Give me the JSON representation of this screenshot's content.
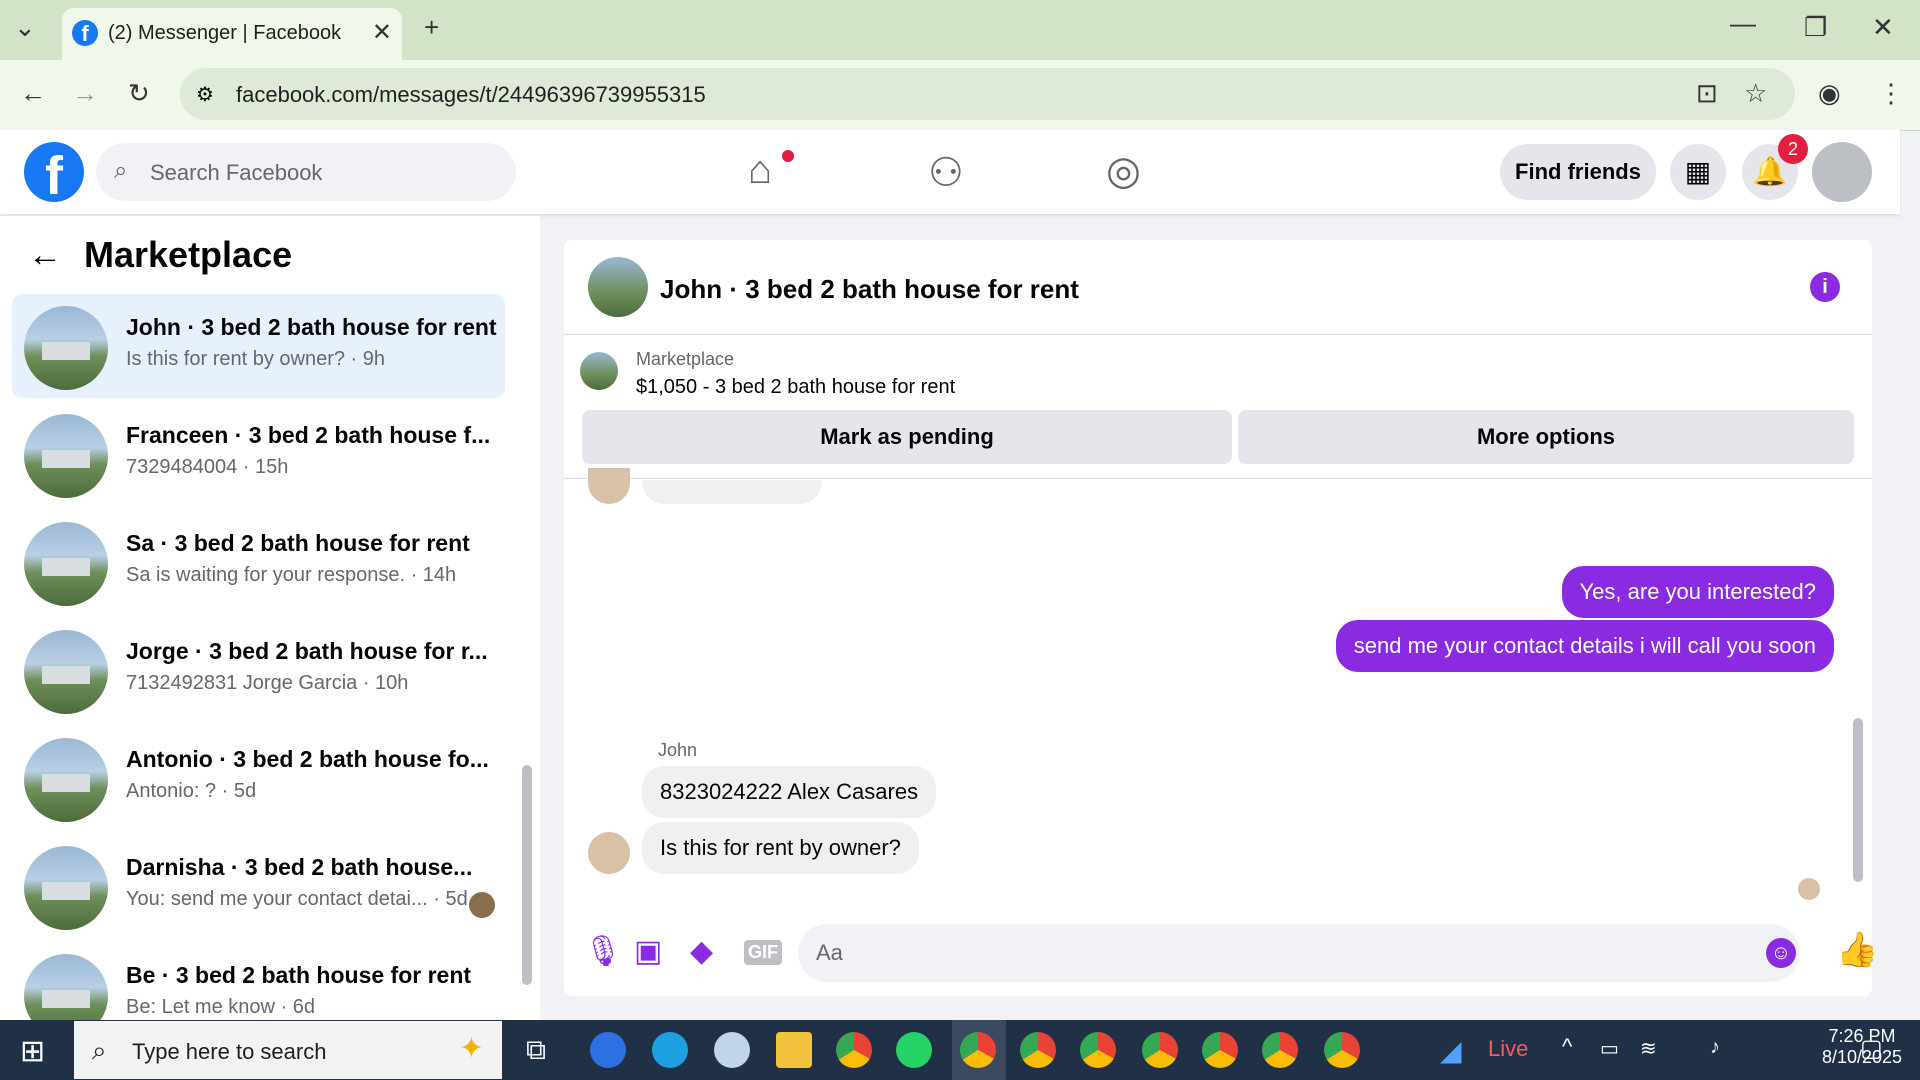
{
  "browser": {
    "tab_title": "(2) Messenger | Facebook",
    "url": "facebook.com/messages/t/24496396739955315"
  },
  "header": {
    "search_placeholder": "Search Facebook",
    "find_friends": "Find friends",
    "notifications_count": "2"
  },
  "sidebar": {
    "title": "Marketplace",
    "conversations": [
      {
        "name": "John · 3 bed 2 bath house for rent",
        "preview": "Is this for rent by owner? · 9h",
        "active": true
      },
      {
        "name": "Franceen · 3 bed 2 bath house f...",
        "preview": "7329484004 · 15h"
      },
      {
        "name": "Sa · 3 bed 2 bath house for rent",
        "preview": "Sa is waiting for your response. · 14h"
      },
      {
        "name": "Jorge · 3 bed 2 bath house for r...",
        "preview": "7132492831 Jorge Garcia · 10h"
      },
      {
        "name": "Antonio · 3 bed 2 bath house fo...",
        "preview": "Antonio: ? · 5d"
      },
      {
        "name": "Darnisha · 3 bed 2 bath house...",
        "preview": "You: send me your contact detai... · 5d"
      },
      {
        "name": "Be · 3 bed 2 bath house for rent",
        "preview": "Be: Let me know · 6d"
      }
    ]
  },
  "chat": {
    "title": "John · 3 bed 2 bath house for rent",
    "marketplace_label": "Marketplace",
    "listing": "$1,050 - 3 bed 2 bath house for rent",
    "mark_pending": "Mark as pending",
    "more_options": "More options",
    "messages_out": [
      "Yes, are you interested?",
      "send me your contact details i will call you soon"
    ],
    "sender_name": "John",
    "messages_in": [
      "8323024222 Alex Casares",
      "Is this for rent by owner?"
    ],
    "composer_placeholder": "Aa"
  },
  "taskbar": {
    "search_placeholder": "Type here to search",
    "live": "Live",
    "time": "7:26 PM",
    "date": "8/10/2025"
  },
  "colors": {
    "facebook_blue": "#1877f2",
    "messenger_purple": "#8a2be2",
    "taskbar": "#203047"
  }
}
